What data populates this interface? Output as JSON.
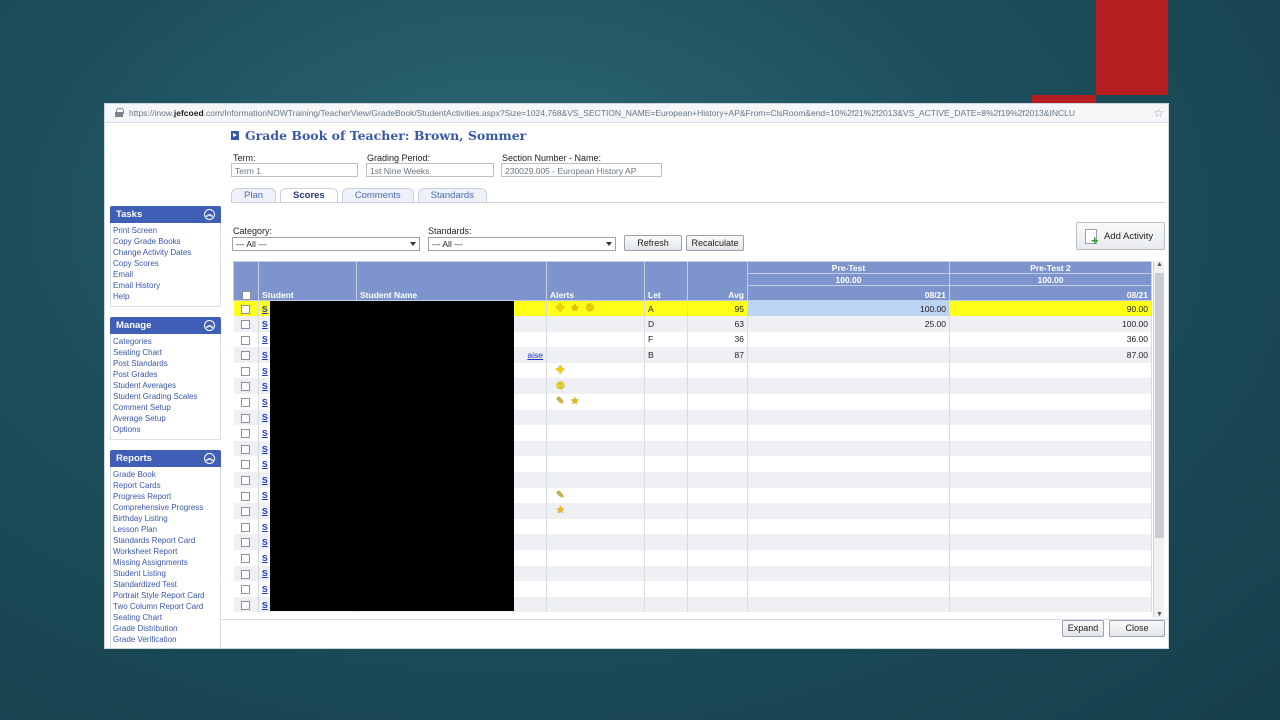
{
  "url": {
    "prefix": "https://inow.",
    "domain": "jefcoed",
    "suffix": ".com/InformationNOWTraining/TeacherView/GradeBook/StudentActivities.aspx?Size=1024,768&VS_SECTION_NAME=European+History+AP&From=ClsRoom&end=10%2f21%2f2013&VS_ACTIVE_DATE=8%2f19%2f2013&INCLU"
  },
  "page_title": "Grade Book of Teacher: Brown, Sommer",
  "term": {
    "label": "Term:",
    "value": "Term 1"
  },
  "grading_period": {
    "label": "Grading Period:",
    "value": "1st Nine Weeks"
  },
  "section": {
    "label": "Section Number - Name:",
    "value": "230029.005 - European History AP"
  },
  "tabs": [
    "Plan",
    "Scores",
    "Comments",
    "Standards"
  ],
  "sidebar": {
    "tasks": {
      "title": "Tasks",
      "items": [
        "Print Screen",
        "Copy Grade Books",
        "Change Activity Dates",
        "Copy Scores",
        "Email",
        "Email History",
        "Help"
      ]
    },
    "manage": {
      "title": "Manage",
      "items": [
        "Categories",
        "Seating Chart",
        "Post Standards",
        "Post Grades",
        "Student Averages",
        "Student Grading Scales",
        "Comment Setup",
        "Average Setup",
        "Options"
      ]
    },
    "reports": {
      "title": "Reports",
      "items": [
        "Grade Book",
        "Report Cards",
        "Progress Report",
        "Comprehensive Progress",
        "Birthday Listing",
        "Lesson Plan",
        "Standards Report Card",
        "Worksheet Report",
        "Missing Assignments",
        "Student Listing",
        "Standardized Test",
        "Portrait Style Report Card",
        "Two Column Report Card",
        "Seating Chart",
        "Grade Distribution",
        "Grade Verification"
      ]
    }
  },
  "filters": {
    "category_label": "Category:",
    "category_value": "--- All ---",
    "standards_label": "Standards:",
    "standards_value": "--- All ---",
    "refresh": "Refresh",
    "recalculate": "Recalculate",
    "add_activity": "Add Activity"
  },
  "grid": {
    "headers": {
      "student": "Student",
      "student_name": "Student Name",
      "alerts": "Alerts",
      "let": "Let",
      "avg": "Avg"
    },
    "activities": [
      {
        "name": "Pre-Test",
        "points": "100.00",
        "date": "08/21"
      },
      {
        "name": "Pre-Test 2",
        "points": "100.00",
        "date": "08/21"
      }
    ],
    "partial_name": "aise",
    "rows": [
      {
        "student": "S",
        "let": "A",
        "avg": "95",
        "s1": "100.00",
        "s2": "90.00",
        "alerts": [
          "plus",
          "star",
          "bulb"
        ]
      },
      {
        "student": "S",
        "let": "D",
        "avg": "63",
        "s1": "25.00",
        "s2": "100.00",
        "alerts": []
      },
      {
        "student": "S",
        "let": "F",
        "avg": "36",
        "s1": "",
        "s2": "36.00",
        "alerts": []
      },
      {
        "student": "S",
        "let": "B",
        "avg": "87",
        "s1": "",
        "s2": "87.00",
        "alerts": []
      },
      {
        "student": "S",
        "let": "",
        "avg": "",
        "s1": "",
        "s2": "",
        "alerts": [
          "plus"
        ]
      },
      {
        "student": "S",
        "let": "",
        "avg": "",
        "s1": "",
        "s2": "",
        "alerts": [
          "bulb"
        ]
      },
      {
        "student": "S",
        "let": "",
        "avg": "",
        "s1": "",
        "s2": "",
        "alerts": [
          "pencil",
          "star"
        ]
      },
      {
        "student": "S",
        "let": "",
        "avg": "",
        "s1": "",
        "s2": "",
        "alerts": []
      },
      {
        "student": "S",
        "let": "",
        "avg": "",
        "s1": "",
        "s2": "",
        "alerts": []
      },
      {
        "student": "S",
        "let": "",
        "avg": "",
        "s1": "",
        "s2": "",
        "alerts": []
      },
      {
        "student": "S",
        "let": "",
        "avg": "",
        "s1": "",
        "s2": "",
        "alerts": []
      },
      {
        "student": "S",
        "let": "",
        "avg": "",
        "s1": "",
        "s2": "",
        "alerts": []
      },
      {
        "student": "S",
        "let": "",
        "avg": "",
        "s1": "",
        "s2": "",
        "alerts": [
          "pencil"
        ]
      },
      {
        "student": "S",
        "let": "",
        "avg": "",
        "s1": "",
        "s2": "",
        "alerts": [
          "star"
        ]
      },
      {
        "student": "S",
        "let": "",
        "avg": "",
        "s1": "",
        "s2": "",
        "alerts": []
      },
      {
        "student": "S",
        "let": "",
        "avg": "",
        "s1": "",
        "s2": "",
        "alerts": []
      },
      {
        "student": "S",
        "let": "",
        "avg": "",
        "s1": "",
        "s2": "",
        "alerts": []
      },
      {
        "student": "S",
        "let": "",
        "avg": "",
        "s1": "",
        "s2": "",
        "alerts": []
      },
      {
        "student": "S",
        "let": "",
        "avg": "",
        "s1": "",
        "s2": "",
        "alerts": []
      },
      {
        "student": "S",
        "let": "",
        "avg": "",
        "s1": "",
        "s2": "",
        "alerts": []
      }
    ]
  },
  "footer": {
    "expand": "Expand",
    "close": "Close"
  },
  "icons": {
    "plus": "plus-alert-icon",
    "star": "star-alert-icon",
    "bulb": "lightbulb-alert-icon",
    "pencil": "pencil-alert-icon"
  },
  "colors": {
    "accent": "#3f5eb5",
    "highlight_row": "#ffff1a",
    "slide_red": "#b61d20"
  }
}
